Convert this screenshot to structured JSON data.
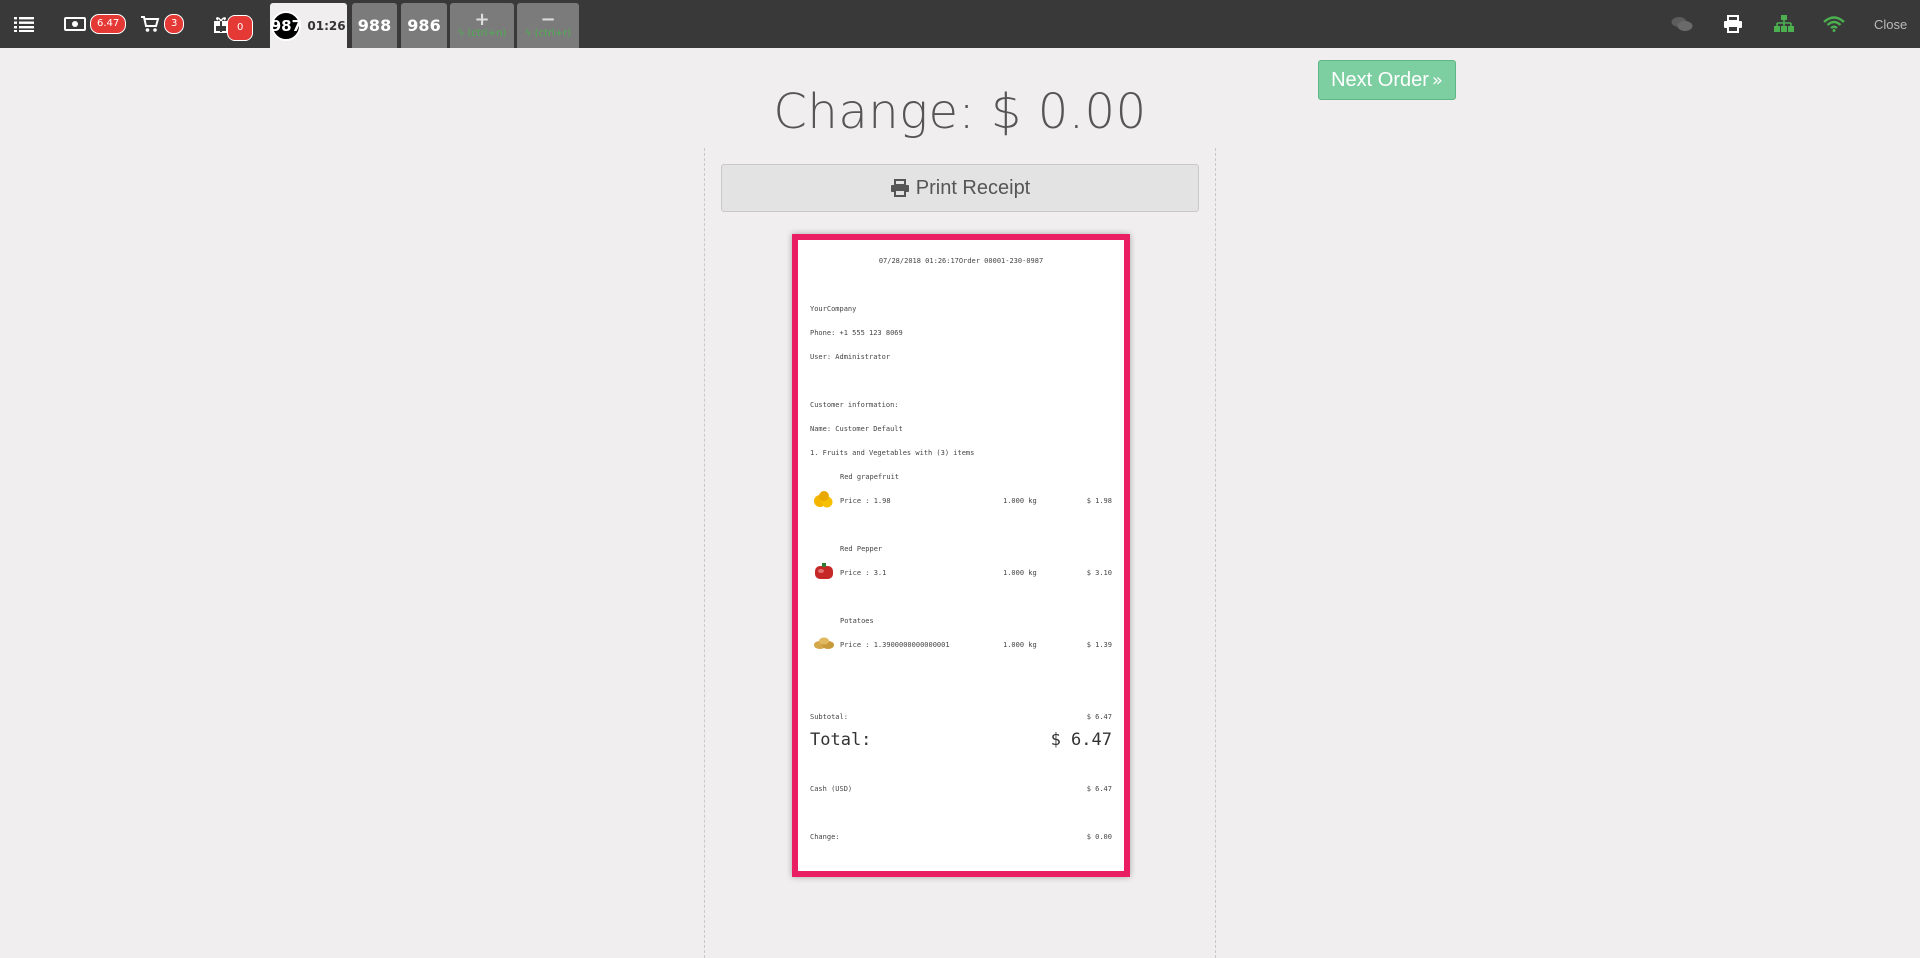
{
  "topbar": {
    "cash_badge": "6.47",
    "cart_badge": "3",
    "gift_badge": "0",
    "active_order": {
      "number": "987",
      "time": "01:26"
    },
    "orders": [
      "988",
      "986"
    ],
    "new_order_shortcut": "(ctrl+n)",
    "remove_order_shortcut": "(ctrl+r)",
    "close_label": "Close",
    "colors": {
      "bar": "#393939",
      "badge": "#e53935",
      "online": "#4caf50"
    }
  },
  "main": {
    "next_order_label": "Next Order",
    "change_title": "Change: $ 0.00",
    "print_receipt_label": "Print Receipt"
  },
  "receipt": {
    "header": "07/28/2018 01:26:17Order 00001-230-0987",
    "company": "YourCompany",
    "phone": "Phone: +1 555 123 8069",
    "user": "User: Administrator",
    "customer_info_label": "Customer information:",
    "customer_name": "Name: Customer Default",
    "category_line": "1. Fruits and Vegetables with (3) items",
    "items": [
      {
        "name": "Red grapefruit",
        "price": "Price : 1.98",
        "qty": "1.000 kg",
        "amount": "$ 1.98",
        "icon": "grapefruit-image"
      },
      {
        "name": "Red Pepper",
        "price": "Price : 3.1",
        "qty": "1.000 kg",
        "amount": "$ 3.10",
        "icon": "red-pepper-image"
      },
      {
        "name": "Potatoes",
        "price": "Price : 1.3900000000000001",
        "qty": "1.000 kg",
        "amount": "$ 1.39",
        "icon": "potatoes-image"
      }
    ],
    "subtotal_label": "Subtotal:",
    "subtotal_value": "$ 6.47",
    "total_label": "Total:",
    "total_value": "$ 6.47",
    "payment_label": "Cash (USD)",
    "payment_value": "$ 6.47",
    "change_label": "Change:",
    "change_value": "$ 0.00"
  }
}
